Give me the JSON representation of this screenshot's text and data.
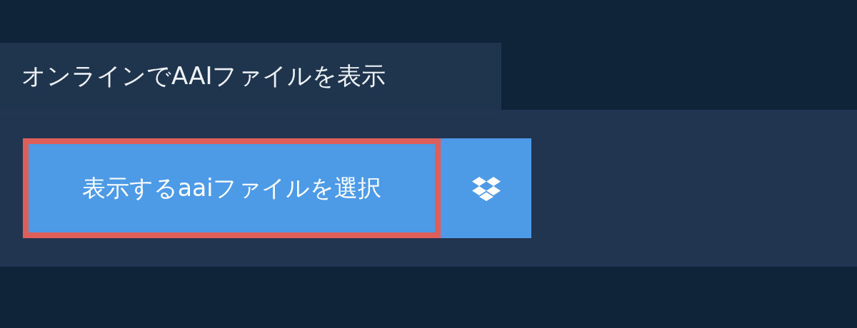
{
  "tab": {
    "label": "オンラインでAAIファイルを表示"
  },
  "upload": {
    "label": "表示するaaiファイルを選択",
    "focused": true
  },
  "dropbox_button": {
    "kind": "dropbox"
  }
}
